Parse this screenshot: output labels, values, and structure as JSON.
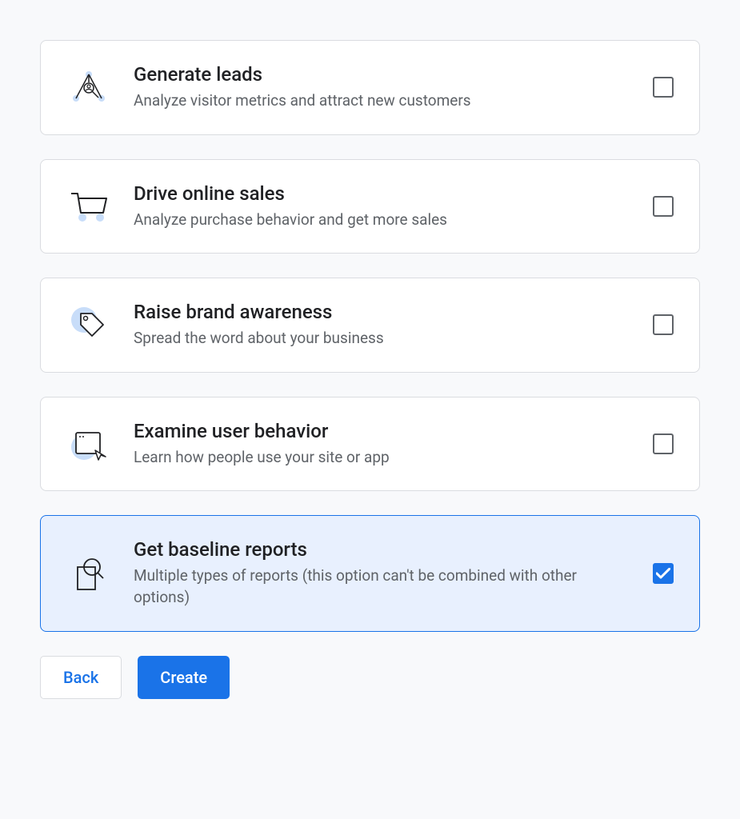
{
  "options": [
    {
      "id": "generate-leads",
      "title": "Generate leads",
      "description": "Analyze visitor metrics and attract new customers",
      "checked": false
    },
    {
      "id": "drive-online-sales",
      "title": "Drive online sales",
      "description": "Analyze purchase behavior and get more sales",
      "checked": false
    },
    {
      "id": "raise-brand-awareness",
      "title": "Raise brand awareness",
      "description": "Spread the word about your business",
      "checked": false
    },
    {
      "id": "examine-user-behavior",
      "title": "Examine user behavior",
      "description": "Learn how people use your site or app",
      "checked": false
    },
    {
      "id": "get-baseline-reports",
      "title": "Get baseline reports",
      "description": "Multiple types of reports (this option can't be combined with other options)",
      "checked": true
    }
  ],
  "buttons": {
    "back": "Back",
    "create": "Create"
  }
}
